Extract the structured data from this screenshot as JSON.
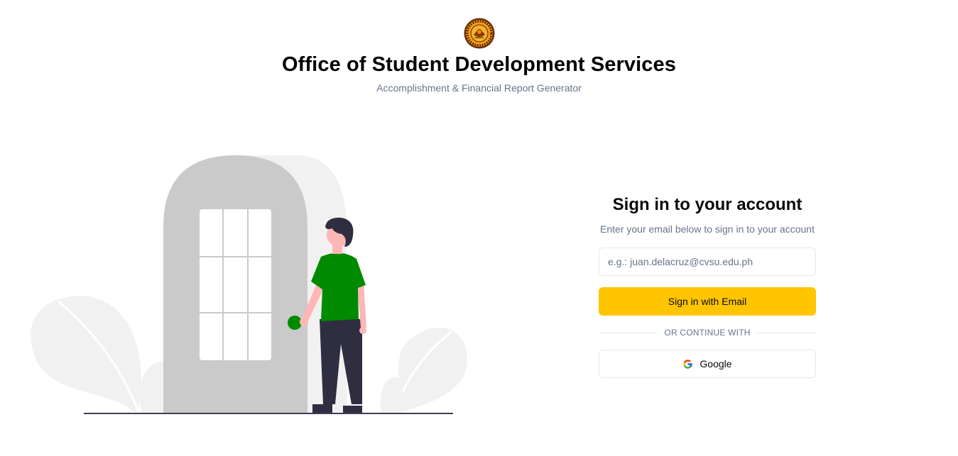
{
  "header": {
    "logo_icon": "university-seal-logo",
    "title": "Office of Student Development Services",
    "subtitle": "Accomplishment & Financial Report Generator"
  },
  "illustration": {
    "icon": "person-at-door-illustration",
    "accent_color": "#008a00"
  },
  "signin": {
    "title": "Sign in to your account",
    "description": "Enter your email below to sign in to your account",
    "email_placeholder": "e.g.: juan.delacruz@cvsu.edu.ph",
    "email_value": "",
    "email_button_label": "Sign in with Email",
    "divider_text": "OR CONTINUE WITH",
    "google_button_label": "Google",
    "google_icon": "google-icon"
  },
  "colors": {
    "primary_button": "#fec500",
    "muted_text": "#64748b",
    "border": "#e2e8f0"
  }
}
